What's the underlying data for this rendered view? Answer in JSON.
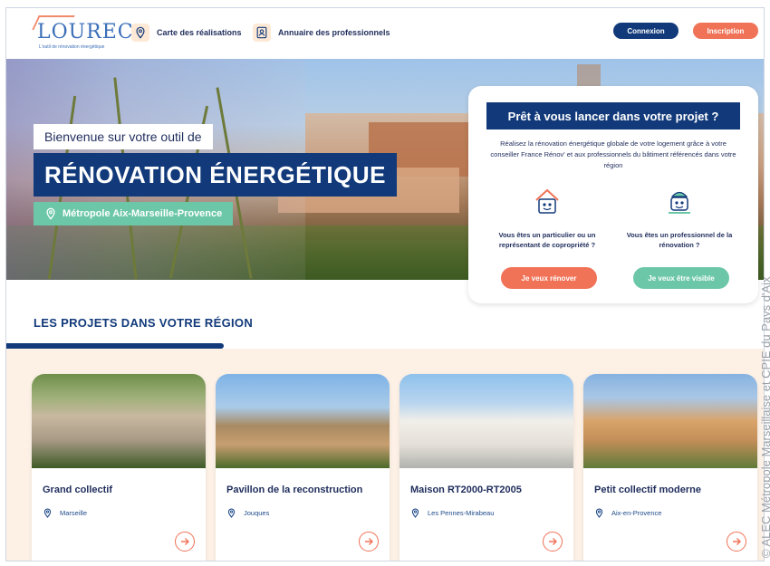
{
  "header": {
    "logo_text": "LOUREC",
    "logo_subtitle": "L'outil de rénovation énergétique",
    "nav": [
      {
        "label": "Carte des réalisations",
        "icon": "map-pin-icon"
      },
      {
        "label": "Annuaire des professionnels",
        "icon": "user-badge-icon"
      }
    ],
    "login_label": "Connexion",
    "signup_label": "Inscription"
  },
  "hero": {
    "welcome": "Bienvenue sur votre outil de",
    "title": "RÉNOVATION ÉNERGÉTIQUE",
    "location": "Métropole Aix-Marseille-Provence"
  },
  "cta": {
    "title": "Prêt à vous lancer dans votre projet ?",
    "description": "Réalisez la rénovation énergétique globale de votre logement grâce à votre conseiller France Rénov' et aux professionnels du bâtiment référencés dans votre région",
    "individual_question": "Vous êtes un particulier ou un représentant de copropriété ?",
    "pro_question": "Vous êtes un professionnel de la rénovation ?",
    "renovate_label": "Je veux rénover",
    "visible_label": "Je veux être visible"
  },
  "projects": {
    "title": "LES PROJETS DANS VOTRE RÉGION",
    "items": [
      {
        "name": "Grand collectif",
        "location": "Marseille"
      },
      {
        "name": "Pavillon de la reconstruction",
        "location": "Jouques"
      },
      {
        "name": "Maison RT2000-RT2005",
        "location": "Les Pennes-Mirabeau"
      },
      {
        "name": "Petit collectif moderne",
        "location": "Aix-en-Provence"
      }
    ]
  },
  "credit": "© ALEC Métropole Marseillaise et CPIE du Pays d'Aix",
  "colors": {
    "navy": "#123a7a",
    "coral": "#f07257",
    "mint": "#6cc7a8",
    "cream": "#fdf1e6"
  }
}
